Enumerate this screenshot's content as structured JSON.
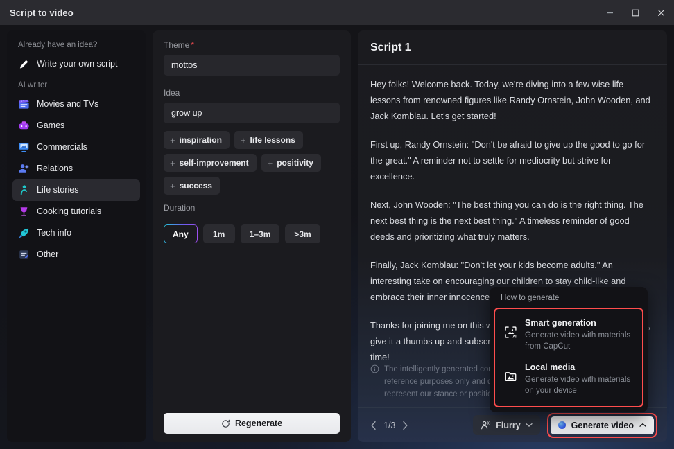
{
  "window": {
    "title": "Script to video",
    "controls": {
      "minimize": "minimize-icon",
      "maximize": "maximize-icon",
      "close": "close-icon"
    }
  },
  "sidebar": {
    "heading_idea": "Already have an idea?",
    "write_own": {
      "label": "Write your own script",
      "icon": "pencil-icon"
    },
    "heading_ai": "AI writer",
    "items": [
      {
        "label": "Movies and TVs",
        "icon": "clapperboard-icon",
        "active": false
      },
      {
        "label": "Games",
        "icon": "gamepad-icon",
        "active": false
      },
      {
        "label": "Commercials",
        "icon": "presentation-icon",
        "active": false
      },
      {
        "label": "Relations",
        "icon": "person-add-icon",
        "active": false
      },
      {
        "label": "Life stories",
        "icon": "person-icon",
        "active": true
      },
      {
        "label": "Cooking tutorials",
        "icon": "wine-glass-icon",
        "active": false
      },
      {
        "label": "Tech info",
        "icon": "rocket-icon",
        "active": false
      },
      {
        "label": "Other",
        "icon": "document-icon",
        "active": false
      }
    ]
  },
  "form": {
    "theme_label": "Theme",
    "theme_required_mark": "*",
    "theme_value": "mottos",
    "theme_placeholder": "",
    "idea_label": "Idea",
    "idea_value": "grow up",
    "idea_placeholder": "",
    "tags": [
      "inspiration",
      "life lessons",
      "self-improvement",
      "positivity",
      "success"
    ],
    "duration_label": "Duration",
    "durations": [
      "Any",
      "1m",
      "1–3m",
      ">3m"
    ],
    "duration_selected": "Any",
    "regenerate_label": "Regenerate",
    "regenerate_icon": "refresh-icon"
  },
  "script": {
    "title": "Script 1",
    "paragraphs": [
      "Hey folks! Welcome back. Today, we're diving into a few wise life lessons from renowned figures like Randy Ornstein, John Wooden, and Jack Komblau. Let's get started!",
      "First up, Randy Ornstein: \"Don't be afraid to give up the good to go for the great.\" A reminder not to settle for mediocrity but strive for excellence.",
      "Next, John Wooden: \"The best thing you can do is the right thing. The next best thing is the next best thing.\" A timeless reminder of good deeds and prioritizing what truly matters.",
      "Finally, Jack Komblau: \"Don't let your kids become adults.\" An interesting take on encouraging our children to stay child-like and embrace their inner innocence.",
      "Thanks for joining me on this wisdom journey! If you enjoyed this video, give it a thumbs up and subscribe for more content like this. Until next time!"
    ],
    "disclaimer": "The intelligently generated content is for reference purposes only and does not represent our stance or position",
    "disclaimer_icon": "info-icon",
    "pager": {
      "prev_icon": "chevron-left-icon",
      "current": "1/3",
      "next_icon": "chevron-right-icon"
    },
    "voice": {
      "label": "Flurry",
      "icon": "voice-icon",
      "caret": "chevron-down-icon"
    },
    "generate": {
      "label": "Generate video",
      "caret": "chevron-up-icon",
      "highlight_color": "#ff4d4d"
    }
  },
  "popup": {
    "title": "How to generate",
    "highlight_color": "#ff4d4d",
    "items": [
      {
        "title": "Smart generation",
        "subtitle": "Generate video with materials from CapCut",
        "icon": "ai-media-icon"
      },
      {
        "title": "Local media",
        "subtitle": "Generate video with materials on your device",
        "icon": "folder-image-icon"
      }
    ]
  }
}
